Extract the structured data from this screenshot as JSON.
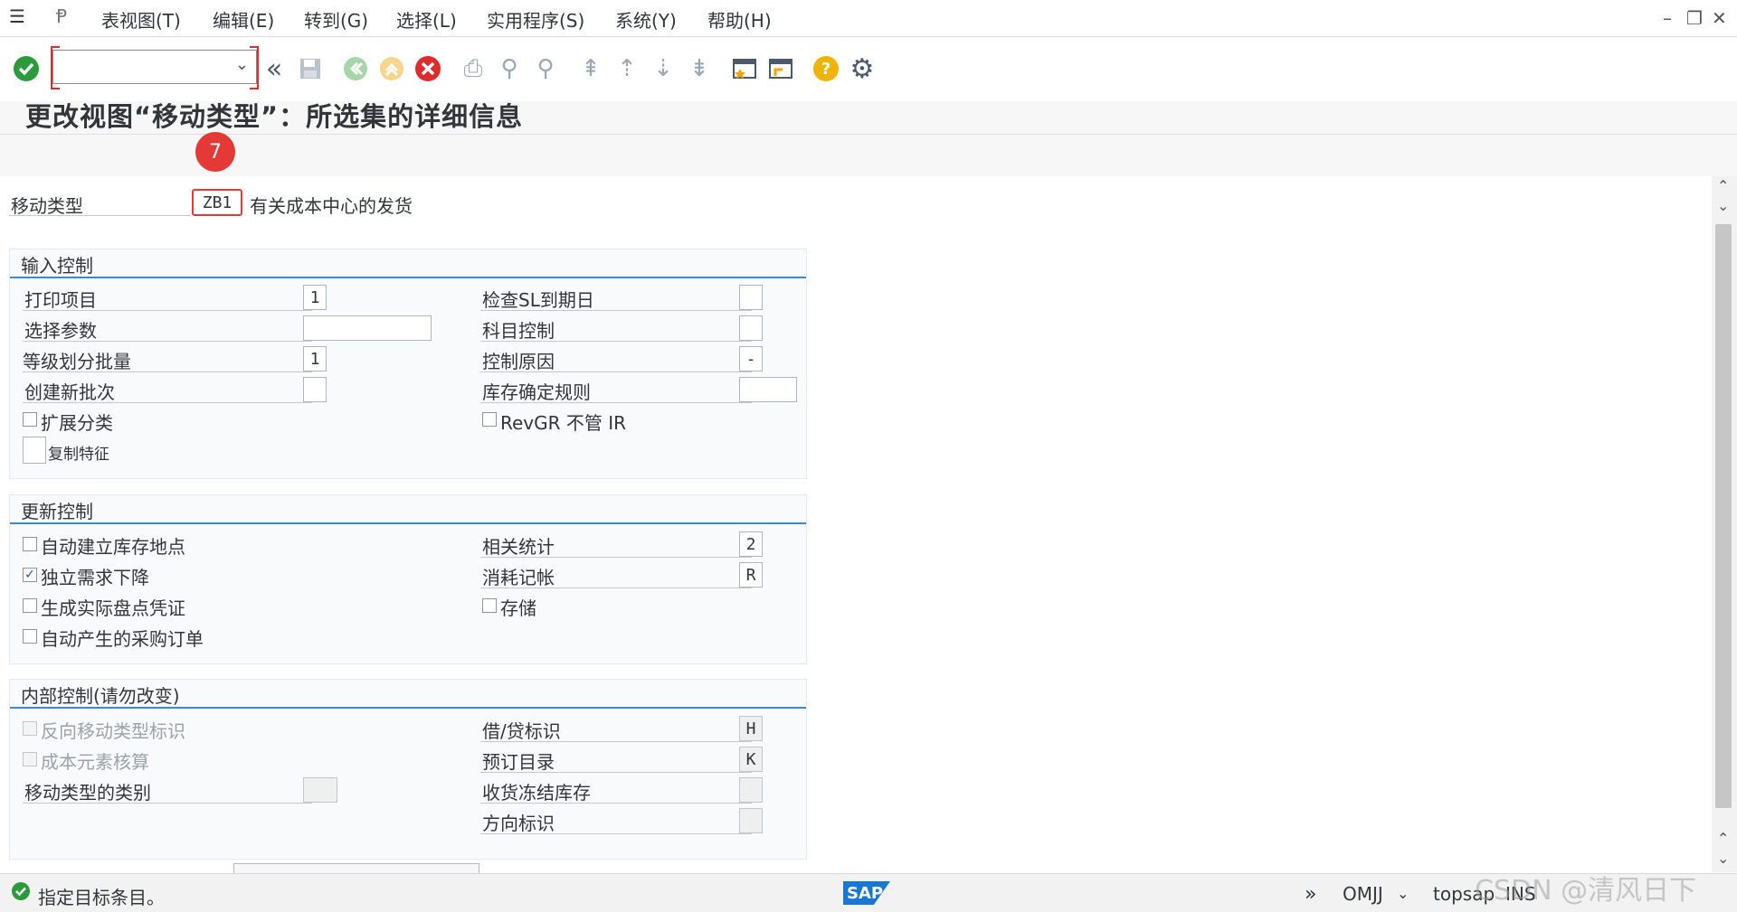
{
  "menubar": {
    "items": [
      "表视图(T)",
      "编辑(E)",
      "转到(G)",
      "选择(L)",
      "实用程序(S)",
      "系统(Y)",
      "帮助(H)"
    ]
  },
  "toolbar": {
    "command_value": "",
    "icons": [
      "enter-icon",
      "back-icon",
      "save-icon",
      "back-green-icon",
      "exit-icon",
      "cancel-icon",
      "print-icon",
      "find-icon",
      "find-next-icon",
      "first-page-icon",
      "prev-page-icon",
      "next-page-icon",
      "last-page-icon",
      "create-session-icon",
      "shortcut-icon",
      "help-icon",
      "settings-icon"
    ]
  },
  "page": {
    "title": "更改视图“移动类型”：所选集的详细信息",
    "step_badge": "7"
  },
  "header": {
    "movement_type_label": "移动类型",
    "movement_type_value": "ZB1",
    "movement_type_desc": "有关成本中心的发货"
  },
  "entry_control": {
    "title": "输入控制",
    "print_item_label": "打印项目",
    "print_item_value": "1",
    "selection_param_label": "选择参数",
    "selection_param_value": "",
    "batch_classif_label": "等级划分批量",
    "batch_classif_value": "1",
    "create_new_batch_label": "创建新批次",
    "create_new_batch_value": "",
    "extended_classif_label": "扩展分类",
    "copy_chars_label": "复制特征",
    "check_sled_label": "检查SL到期日",
    "check_sled_value": "",
    "acct_control_label": "科目控制",
    "acct_control_value": "",
    "control_reason_label": "控制原因",
    "control_reason_value": "-",
    "stock_det_rule_label": "库存确定规则",
    "stock_det_rule_value": "",
    "revgr_label": "RevGR 不管 IR"
  },
  "update_control": {
    "title": "更新控制",
    "auto_create_sloc_label": "自动建立库存地点",
    "auto_create_sloc_checked": false,
    "indep_req_reduction_label": "独立需求下降",
    "indep_req_reduction_checked": true,
    "gen_phys_inv_doc_label": "生成实际盘点凭证",
    "gen_phys_inv_doc_checked": false,
    "auto_po_label": "自动产生的采购订单",
    "auto_po_checked": false,
    "stat_relevant_label": "相关统计",
    "stat_relevant_value": "2",
    "consumption_posting_label": "消耗记帐",
    "consumption_posting_value": "R",
    "store_label": "存储",
    "store_checked": false
  },
  "internal_control": {
    "title": "内部控制(请勿改变)",
    "reversal_ind_label": "反向移动类型标识",
    "cost_element_label": "成本元素核算",
    "mvt_type_category_label": "移动类型的类别",
    "mvt_type_category_value": "",
    "debit_credit_label": "借/贷标识",
    "debit_credit_value": "H",
    "acct_assign_cat_label": "预订目录",
    "acct_assign_cat_value": "K",
    "gr_blocked_stock_label": "收货冻结库存",
    "gr_blocked_stock_value": "",
    "direction_ind_label": "方向标识",
    "direction_ind_value": ""
  },
  "statusbar": {
    "message": "指定目标条目。",
    "transaction": "OMJJ",
    "system": "topsap",
    "mode": "INS"
  },
  "watermark": "CSDN @清风日下",
  "colors": {
    "accent": "#3c8bc4",
    "highlight": "#e53935",
    "success": "#2b9a3b"
  }
}
